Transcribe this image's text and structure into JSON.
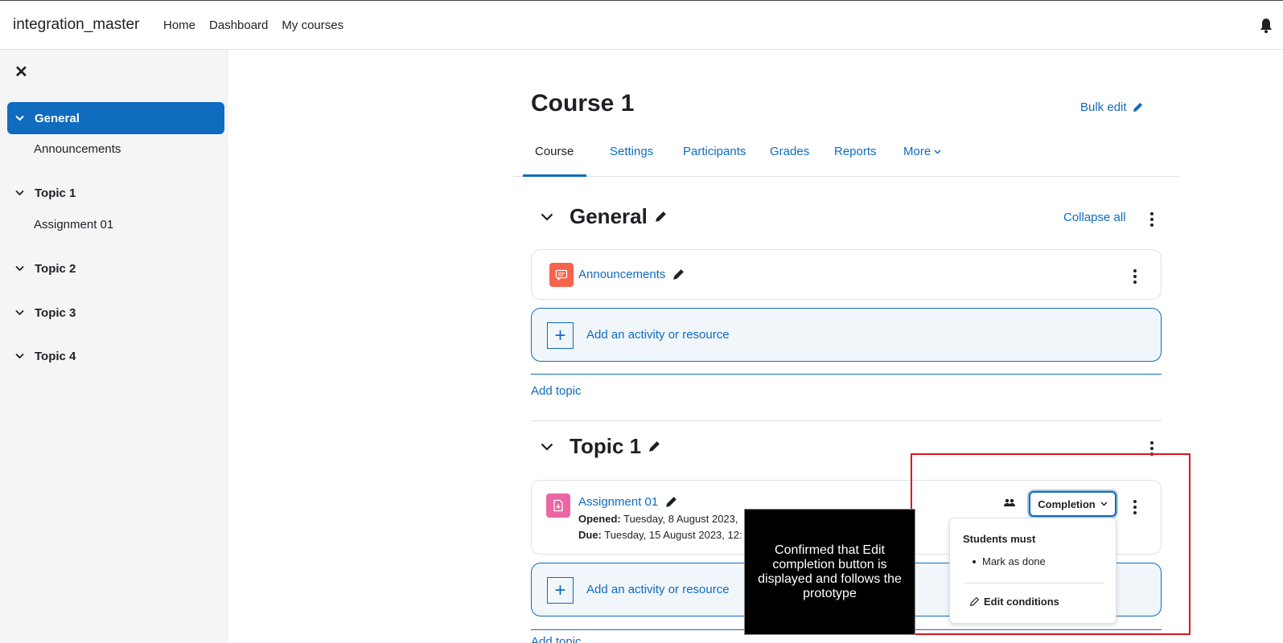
{
  "navbar": {
    "brand": "integration_master",
    "links": [
      "Home",
      "Dashboard",
      "My courses"
    ]
  },
  "drawer": {
    "sections": [
      {
        "label": "General",
        "active": true,
        "items": [
          "Announcements"
        ]
      },
      {
        "label": "Topic 1",
        "active": false,
        "items": [
          "Assignment 01"
        ]
      },
      {
        "label": "Topic 2",
        "active": false,
        "items": []
      },
      {
        "label": "Topic 3",
        "active": false,
        "items": []
      },
      {
        "label": "Topic 4",
        "active": false,
        "items": []
      }
    ]
  },
  "course": {
    "title": "Course 1",
    "bulk_edit": "Bulk edit",
    "tabs": [
      "Course",
      "Settings",
      "Participants",
      "Grades",
      "Reports",
      "More"
    ],
    "active_tab": "Course"
  },
  "general_section": {
    "title": "General",
    "collapse_all": "Collapse all",
    "activity": {
      "name": "Announcements",
      "icon": "forum-icon",
      "icon_color": "#f7634d"
    },
    "add_activity": "Add an activity or resource",
    "add_topic": "Add topic"
  },
  "topic1_section": {
    "title": "Topic 1",
    "activity": {
      "name": "Assignment 01",
      "icon": "assignment-icon",
      "icon_color": "#eb66a2",
      "opened_label": "Opened:",
      "opened_value": "Tuesday, 8 August 2023,",
      "due_label": "Due:",
      "due_value": "Tuesday, 15 August 2023, 12:"
    },
    "completion_button": "Completion",
    "add_activity": "Add an activity or resource",
    "add_topic": "Add topic"
  },
  "completion_popover": {
    "title": "Students must",
    "items": [
      "Mark as done"
    ],
    "edit_conditions": "Edit conditions"
  },
  "annotation": {
    "caption": "Confirmed that Edit completion button is displayed and follows the prototype",
    "highlight_color": "#e0141e"
  },
  "colors": {
    "accent": "#0f6cbf",
    "drawer_bg": "#f5f5f5"
  }
}
